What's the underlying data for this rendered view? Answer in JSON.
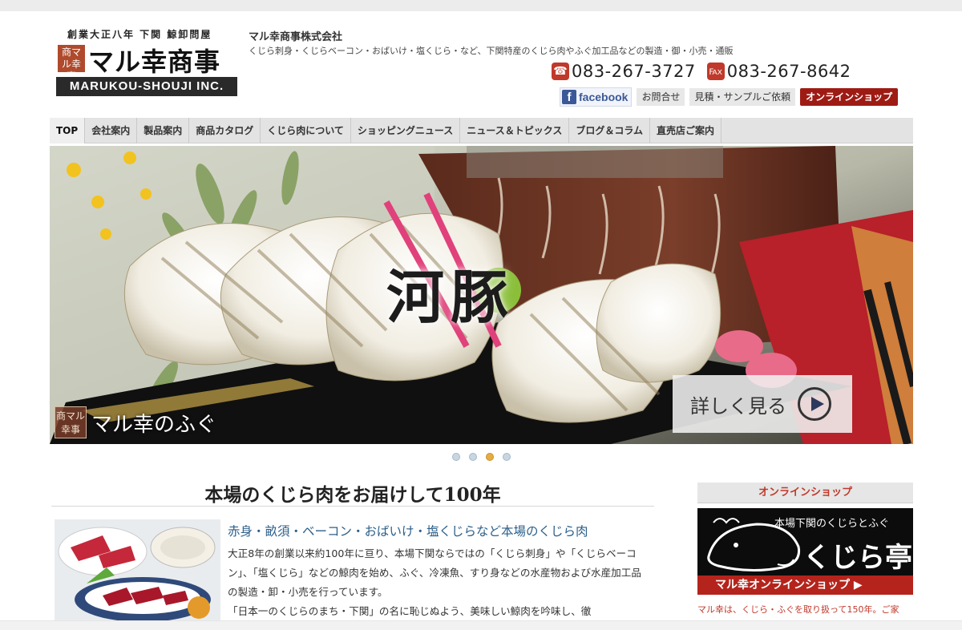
{
  "logo": {
    "tagline": "創業大正八年 下関 鯨卸問屋",
    "seal": "商マル幸事",
    "name": "マル幸商事",
    "english": "MARUKOU-SHOUJI INC."
  },
  "header": {
    "company": "マル幸商事株式会社",
    "description": "くじら刺身・くじらベーコン・おばいけ・塩くじら・など、下関特産のくじら肉やふぐ加工品などの製造・御・小売・通販",
    "phone": "083-267-3727",
    "fax": "083-267-8642",
    "facebook": "facebook",
    "contact": "お問合せ",
    "estimate": "見積・サンプルご依頼",
    "online_shop": "オンラインショップ",
    "phone_icon": "phone-icon",
    "fax_icon": "fax-icon"
  },
  "nav": {
    "items": [
      {
        "label": "TOP"
      },
      {
        "label": "会社案内"
      },
      {
        "label": "製品案内"
      },
      {
        "label": "商品カタログ"
      },
      {
        "label": "くじら肉について"
      },
      {
        "label": "ショッピングニュース"
      },
      {
        "label": "ニュース＆トピックス"
      },
      {
        "label": "ブログ＆コラム"
      },
      {
        "label": "直売店ご案内"
      }
    ],
    "active_index": 0
  },
  "hero": {
    "title": "河豚",
    "brand_seal": "商マル幸事",
    "brand": "マル幸のふぐ",
    "more": "詳しく見る",
    "slides": 4,
    "current_slide": 3
  },
  "main": {
    "heading": "本場のくじら肉をお届けして100年",
    "subheading": "赤身・畝須・ベーコン・おばいけ・塩くじらなど本場のくじら肉",
    "paragraph1": "大正8年の創業以来約100年に亘り、本場下関ならではの「くじら刺身」や「くじらベーコン」、「塩くじら」などの鯨肉を始め、ふぐ、冷凍魚、すり身などの水産物および水産加工品の製造・卸・小売を行っています。",
    "paragraph2": "「日本一のくじらのまち・下関」の名に恥じぬよう、美味しい鯨肉を吟味し、徹"
  },
  "sidebar": {
    "heading": "オンラインショップ",
    "banner_top": "本場下関のくじらとふぐ",
    "banner_name": "くじら亭",
    "banner_bar": "マル幸オンラインショップ ▶",
    "text": "マル幸は、くじら・ふぐを取り扱って150年。ご家"
  },
  "colors": {
    "accent_red": "#9e1b14",
    "link_blue": "#2c5f8a",
    "facebook_blue": "#3b5998",
    "dot_active": "#e4ad42"
  }
}
